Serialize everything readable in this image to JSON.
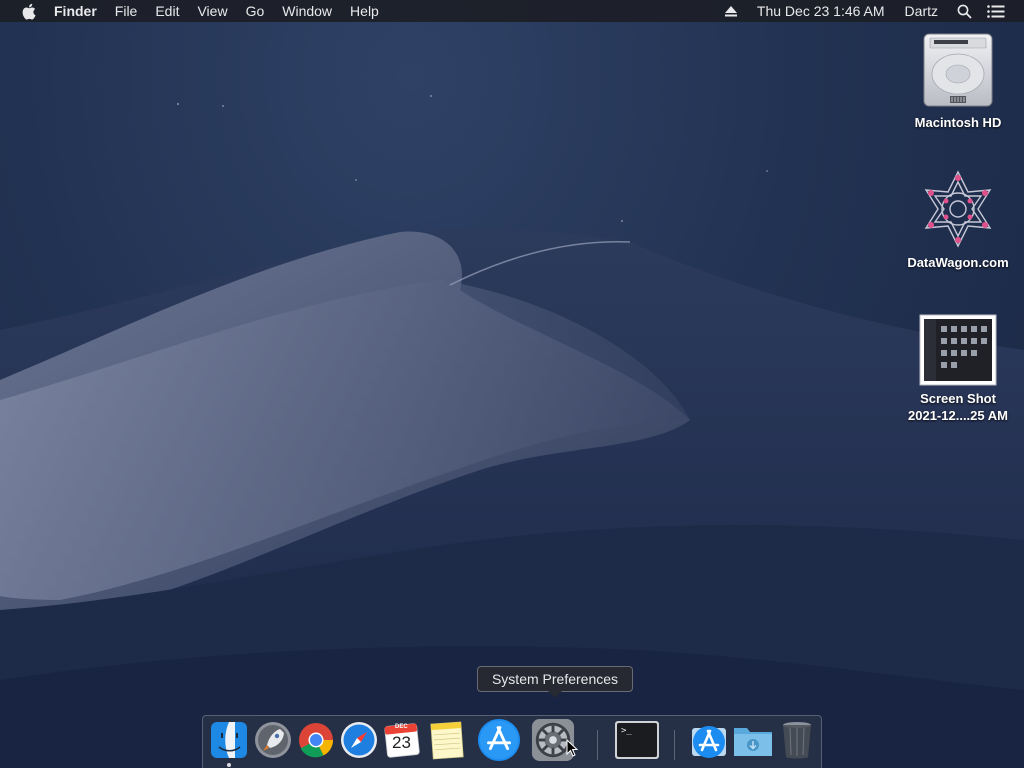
{
  "menubar": {
    "app_name": "Finder",
    "menus": [
      "File",
      "Edit",
      "View",
      "Go",
      "Window",
      "Help"
    ],
    "datetime": "Thu Dec 23  1:46 AM",
    "user": "Dartz"
  },
  "desktop": {
    "icons": [
      {
        "label": "Macintosh HD"
      },
      {
        "label": "DataWagon.com"
      },
      {
        "label_line1": "Screen Shot",
        "label_line2": "2021-12....25 AM"
      }
    ]
  },
  "tooltip": {
    "text": "System Preferences"
  },
  "dock": {
    "apps": [
      "finder-icon",
      "launchpad-icon",
      "chrome-icon",
      "safari-icon",
      "calendar-icon",
      "notes-icon",
      "app-store-icon",
      "system-preferences-icon",
      "terminal-icon",
      "applications-folder-icon",
      "downloads-folder-icon",
      "trash-icon"
    ],
    "calendar_month": "DEC",
    "calendar_day": "23",
    "terminal_prompt": ">_"
  },
  "colors": {
    "wallpaper_dark": "#1a2744",
    "wallpaper_light": "#2f4266",
    "menubar": "#1c1e26"
  }
}
